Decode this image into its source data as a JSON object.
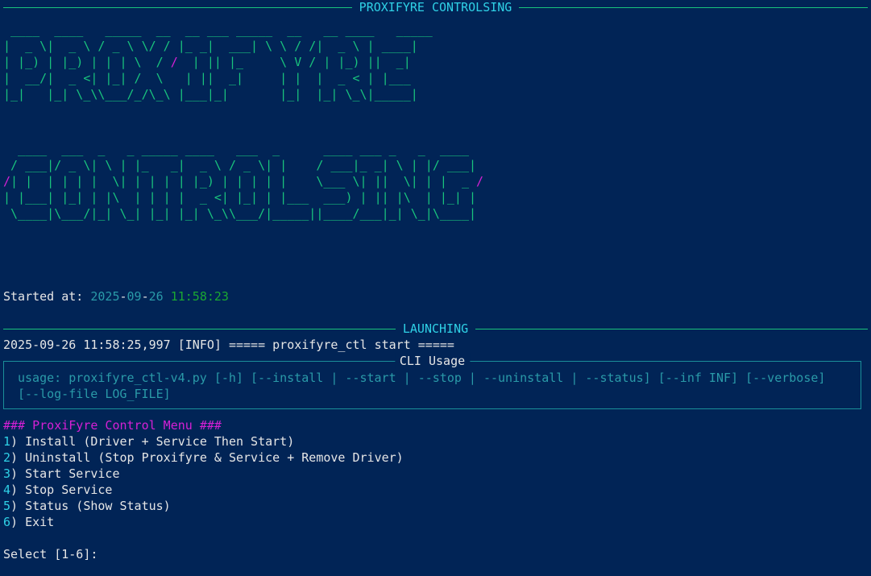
{
  "header": {
    "title": "PROXIFYRE CONTROLSING"
  },
  "banner": {
    "word1": "PROXIFYRE",
    "word2": "CONTROLSING"
  },
  "started": {
    "label": "Started at: ",
    "year": "2025",
    "month": "09",
    "day": "26",
    "time": "11:58:23"
  },
  "launching": {
    "title": "LAUNCHING"
  },
  "log": {
    "line": "2025-09-26 11:58:25,997 [INFO] ===== proxifyre_ctl start ====="
  },
  "cli": {
    "title": "CLI Usage",
    "usage": "usage: proxifyre_ctl-v4.py [-h] [--install | --start | --stop | --uninstall | --status] [--inf INF] [--verbose]\n[--log-file LOG_FILE]"
  },
  "menu": {
    "title": "### ProxiFyre Control Menu ###",
    "items": [
      {
        "num": "1",
        "label": ") Install (Driver + Service Then Start)"
      },
      {
        "num": "2",
        "label": ") Uninstall (Stop Proxifyre & Service + Remove Driver)"
      },
      {
        "num": "3",
        "label": ") Start Service"
      },
      {
        "num": "4",
        "label": ") Stop Service"
      },
      {
        "num": "5",
        "label": ") Status (Show Status)"
      },
      {
        "num": "6",
        "label": ") Exit"
      }
    ]
  },
  "prompt": {
    "text": "Select [1-6]:"
  },
  "colors": {
    "background": "#012456",
    "green": "#19c37d",
    "cyan": "#2fd1e6",
    "magenta": "#d620d6",
    "teal": "#2a9aa8"
  }
}
